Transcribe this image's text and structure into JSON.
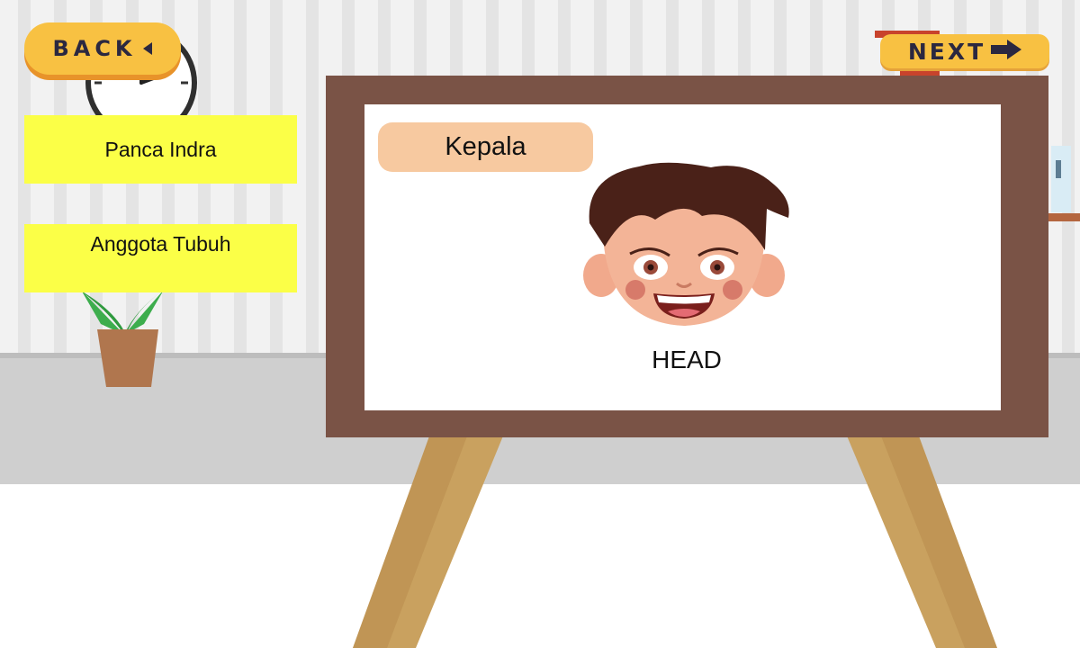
{
  "nav": {
    "back_label": "BACK",
    "back_icon": "triangle-left-icon",
    "next_label": "NEXT",
    "next_icon": "arrow-right-icon"
  },
  "menu": {
    "items": [
      {
        "label": "Panca Indra"
      },
      {
        "label": "Anggota Tubuh"
      }
    ]
  },
  "card": {
    "indonesian_word": "Kepala",
    "english_word": "HEAD",
    "illustration": "boy-head-icon"
  },
  "colors": {
    "button_yellow": "#f8c142",
    "menu_yellow": "#fbff47",
    "label_peach": "#f7c9a0",
    "board_frame": "#7a5346",
    "easel_leg": "#c9a15f"
  }
}
